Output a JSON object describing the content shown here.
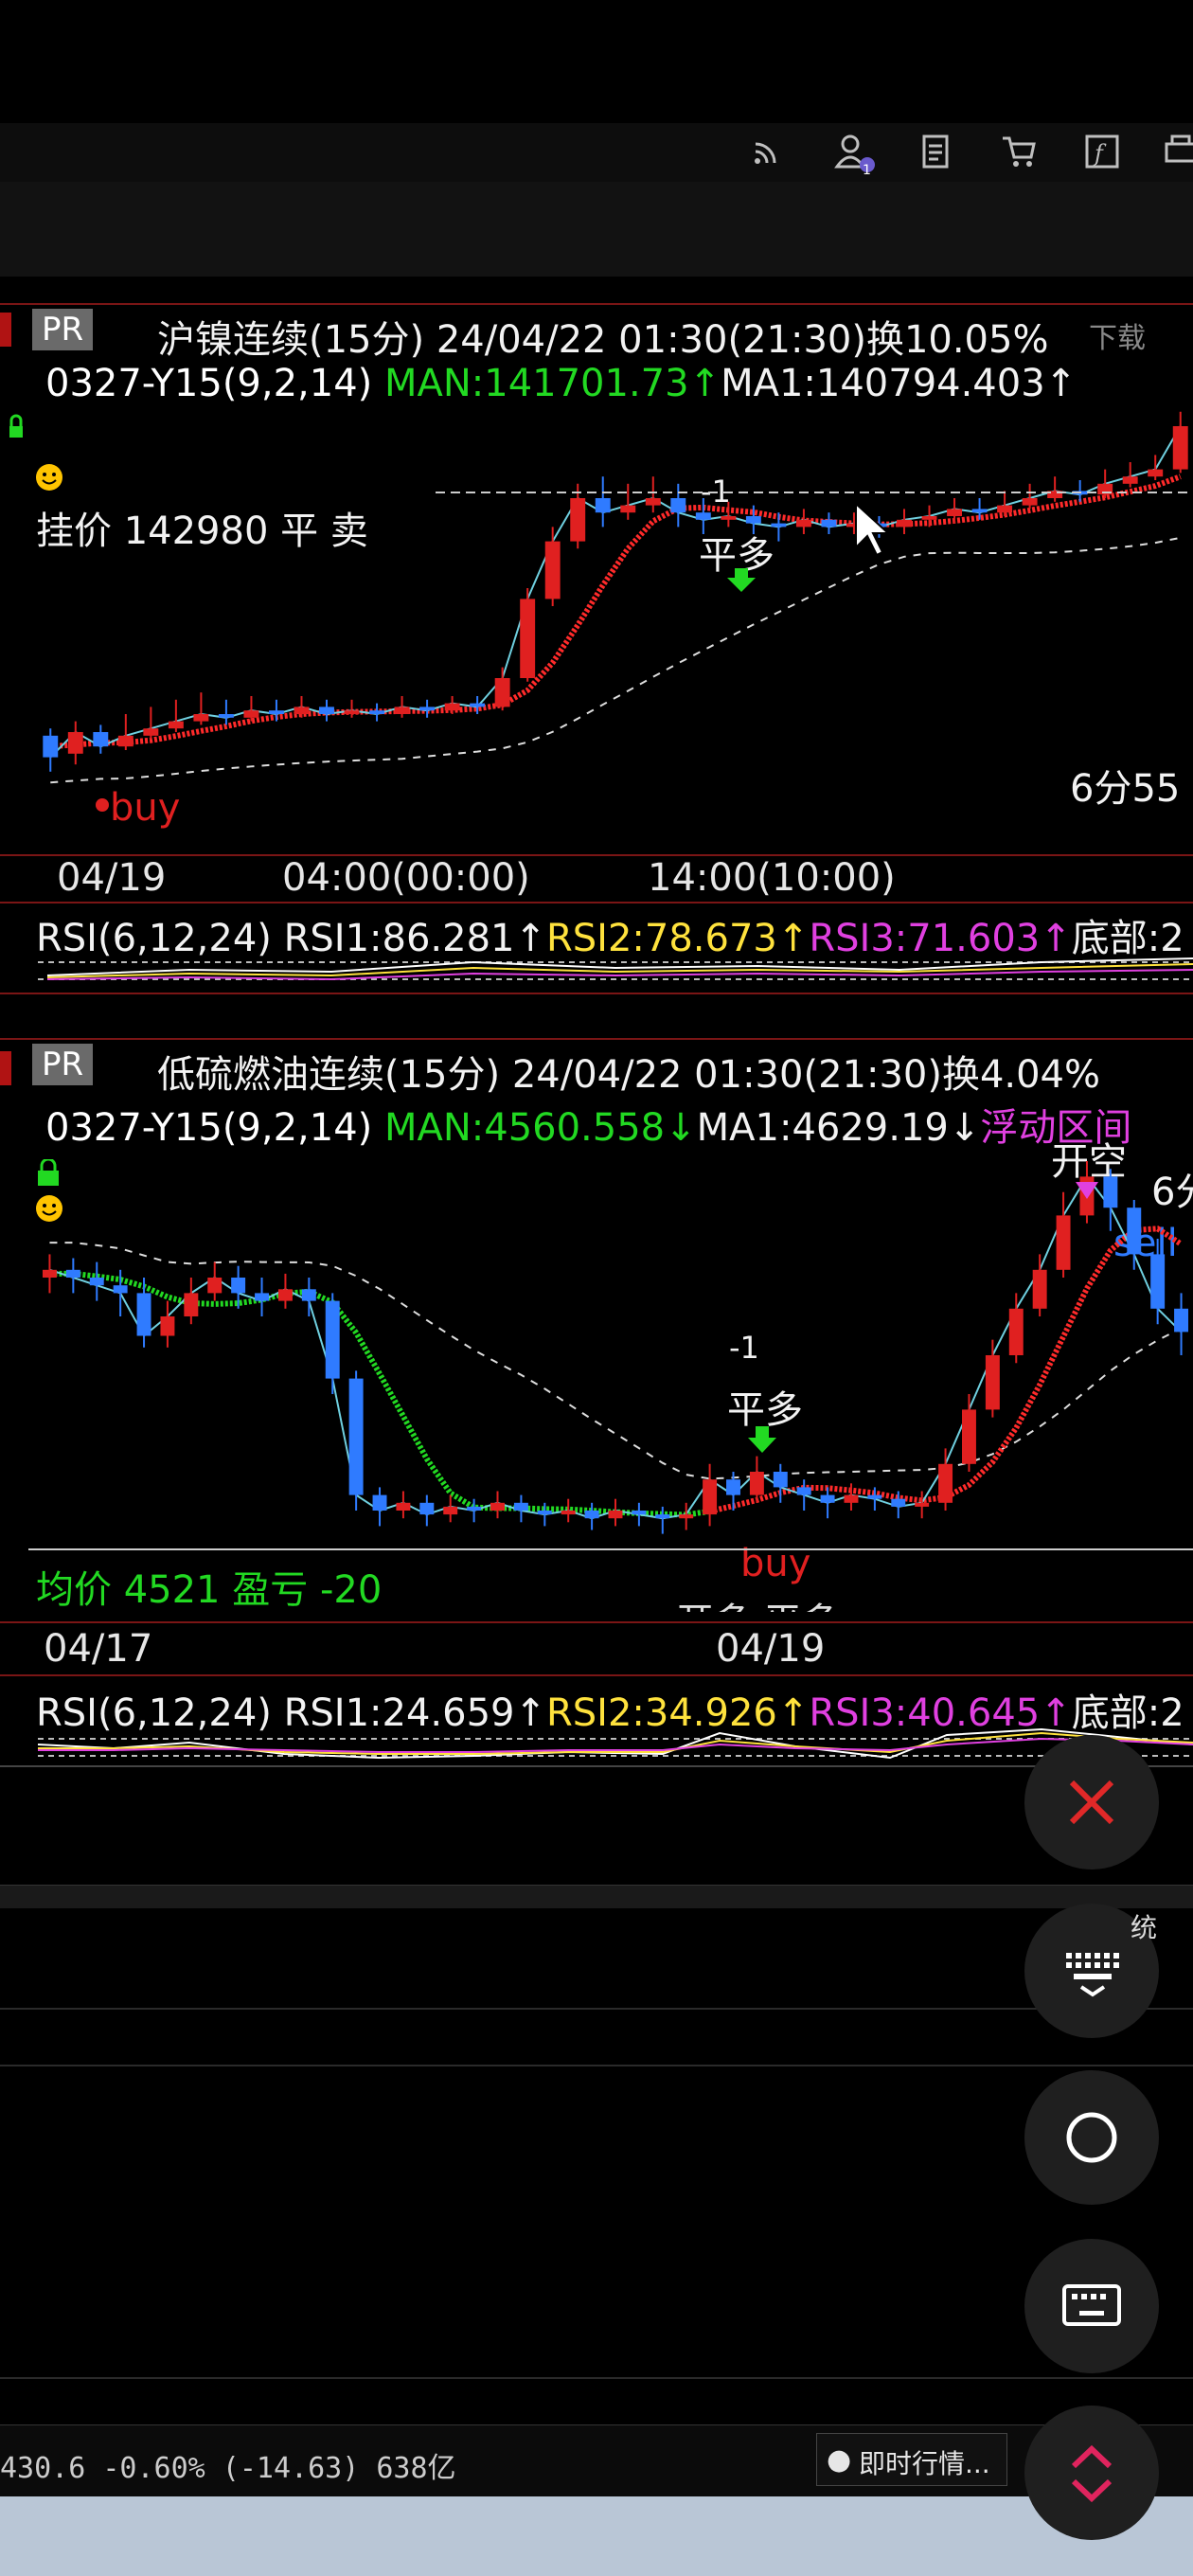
{
  "colors": {
    "up": "#e02020",
    "down": "#2f7bff",
    "ma_green": "#22d922",
    "ma_red": "#ff2a2a",
    "rsi1": "#ffffff",
    "rsi2": "#ffe23d",
    "rsi3": "#e040e0",
    "panel_border": "#7a1515"
  },
  "toolbar": {
    "icons": [
      "rss-icon",
      "user-icon",
      "document-icon",
      "cart-icon",
      "function-icon",
      "print-icon"
    ],
    "user_badge": "1"
  },
  "chart1": {
    "tag": "PR",
    "title": "沪镍连续(15分) 24/04/22 01:30(21:30)换10.05%",
    "download": "下载",
    "indicator_name": "0327-Y15(9,2,14)",
    "man": "MAN:141701.73↑",
    "ma1": "MA1:140794.403↑",
    "order": "挂价 142980 平 卖",
    "signal_minus": "-1",
    "signal_label": "平多",
    "buy_label": "buy",
    "timer": "6分55",
    "dates": [
      "04/19",
      "04:00(00:00)",
      "14:00(10:00)"
    ],
    "candles": [
      {
        "o": 14,
        "c": 8,
        "h": 16,
        "l": 4
      },
      {
        "o": 9,
        "c": 15,
        "h": 18,
        "l": 6
      },
      {
        "o": 15,
        "c": 11,
        "h": 17,
        "l": 9
      },
      {
        "o": 11,
        "c": 14,
        "h": 20,
        "l": 10
      },
      {
        "o": 14,
        "c": 16,
        "h": 22,
        "l": 13
      },
      {
        "o": 16,
        "c": 18,
        "h": 24,
        "l": 15
      },
      {
        "o": 18,
        "c": 20,
        "h": 26,
        "l": 17
      },
      {
        "o": 20,
        "c": 19,
        "h": 24,
        "l": 17
      },
      {
        "o": 19,
        "c": 21,
        "h": 25,
        "l": 18
      },
      {
        "o": 21,
        "c": 20,
        "h": 24,
        "l": 18
      },
      {
        "o": 20,
        "c": 22,
        "h": 25,
        "l": 19
      },
      {
        "o": 22,
        "c": 20,
        "h": 24,
        "l": 18
      },
      {
        "o": 20,
        "c": 21,
        "h": 24,
        "l": 19
      },
      {
        "o": 21,
        "c": 20,
        "h": 23,
        "l": 18
      },
      {
        "o": 20,
        "c": 22,
        "h": 25,
        "l": 19
      },
      {
        "o": 22,
        "c": 21,
        "h": 24,
        "l": 19
      },
      {
        "o": 21,
        "c": 23,
        "h": 25,
        "l": 20
      },
      {
        "o": 23,
        "c": 22,
        "h": 25,
        "l": 20
      },
      {
        "o": 22,
        "c": 30,
        "h": 33,
        "l": 21
      },
      {
        "o": 30,
        "c": 52,
        "h": 55,
        "l": 29
      },
      {
        "o": 52,
        "c": 68,
        "h": 72,
        "l": 50
      },
      {
        "o": 68,
        "c": 80,
        "h": 84,
        "l": 66
      },
      {
        "o": 80,
        "c": 76,
        "h": 86,
        "l": 72
      },
      {
        "o": 76,
        "c": 78,
        "h": 84,
        "l": 74
      },
      {
        "o": 78,
        "c": 80,
        "h": 86,
        "l": 76
      },
      {
        "o": 80,
        "c": 76,
        "h": 84,
        "l": 72
      },
      {
        "o": 76,
        "c": 74,
        "h": 80,
        "l": 70
      },
      {
        "o": 74,
        "c": 75,
        "h": 79,
        "l": 72
      },
      {
        "o": 75,
        "c": 73,
        "h": 78,
        "l": 70
      },
      {
        "o": 73,
        "c": 72,
        "h": 76,
        "l": 68
      },
      {
        "o": 72,
        "c": 74,
        "h": 77,
        "l": 70
      },
      {
        "o": 74,
        "c": 72,
        "h": 76,
        "l": 70
      },
      {
        "o": 72,
        "c": 73,
        "h": 76,
        "l": 70
      },
      {
        "o": 73,
        "c": 72,
        "h": 75,
        "l": 69
      },
      {
        "o": 72,
        "c": 74,
        "h": 77,
        "l": 70
      },
      {
        "o": 74,
        "c": 75,
        "h": 78,
        "l": 72
      },
      {
        "o": 75,
        "c": 77,
        "h": 80,
        "l": 73
      },
      {
        "o": 77,
        "c": 76,
        "h": 80,
        "l": 74
      },
      {
        "o": 76,
        "c": 78,
        "h": 82,
        "l": 75
      },
      {
        "o": 78,
        "c": 80,
        "h": 84,
        "l": 77
      },
      {
        "o": 80,
        "c": 82,
        "h": 86,
        "l": 79
      },
      {
        "o": 82,
        "c": 81,
        "h": 85,
        "l": 79
      },
      {
        "o": 81,
        "c": 84,
        "h": 88,
        "l": 80
      },
      {
        "o": 84,
        "c": 86,
        "h": 90,
        "l": 83
      },
      {
        "o": 86,
        "c": 88,
        "h": 92,
        "l": 85
      },
      {
        "o": 88,
        "c": 100,
        "h": 104,
        "l": 87
      }
    ]
  },
  "rsi1": {
    "name": "RSI(6,12,24)",
    "rsi1": "RSI1:86.281↑",
    "rsi2": "RSI2:78.673↑",
    "rsi3": "RSI3:71.603↑",
    "bottom": "底部:2"
  },
  "chart2": {
    "tag": "PR",
    "title": "低硫燃油连续(15分) 24/04/22 01:30(21:30)换4.04%",
    "indicator_name": "0327-Y15(9,2,14)",
    "man": "MAN:4560.558↓",
    "ma1": "MA1:4629.19↓",
    "float": "浮动区间",
    "open_short": "开空",
    "sell_label": "sell",
    "timer": "6分",
    "signal_minus": "-1",
    "signal_label": "平多",
    "buy_label": "buy",
    "avg": "均价 4521 盈亏 -20",
    "cut_text": "开多 平多",
    "dates": [
      "04/17",
      "04/19"
    ],
    "candles": [
      {
        "o": 70,
        "c": 72,
        "h": 76,
        "l": 66
      },
      {
        "o": 72,
        "c": 70,
        "h": 75,
        "l": 66
      },
      {
        "o": 70,
        "c": 68,
        "h": 74,
        "l": 64
      },
      {
        "o": 68,
        "c": 66,
        "h": 72,
        "l": 60
      },
      {
        "o": 66,
        "c": 55,
        "h": 70,
        "l": 52
      },
      {
        "o": 55,
        "c": 60,
        "h": 64,
        "l": 52
      },
      {
        "o": 60,
        "c": 66,
        "h": 70,
        "l": 58
      },
      {
        "o": 66,
        "c": 70,
        "h": 74,
        "l": 64
      },
      {
        "o": 70,
        "c": 66,
        "h": 73,
        "l": 62
      },
      {
        "o": 66,
        "c": 64,
        "h": 70,
        "l": 60
      },
      {
        "o": 64,
        "c": 67,
        "h": 71,
        "l": 62
      },
      {
        "o": 67,
        "c": 64,
        "h": 70,
        "l": 60
      },
      {
        "o": 64,
        "c": 44,
        "h": 66,
        "l": 40
      },
      {
        "o": 44,
        "c": 14,
        "h": 46,
        "l": 10
      },
      {
        "o": 14,
        "c": 10,
        "h": 16,
        "l": 6
      },
      {
        "o": 10,
        "c": 12,
        "h": 15,
        "l": 8
      },
      {
        "o": 12,
        "c": 9,
        "h": 14,
        "l": 6
      },
      {
        "o": 9,
        "c": 11,
        "h": 14,
        "l": 7
      },
      {
        "o": 11,
        "c": 10,
        "h": 13,
        "l": 7
      },
      {
        "o": 10,
        "c": 12,
        "h": 15,
        "l": 8
      },
      {
        "o": 12,
        "c": 10,
        "h": 14,
        "l": 7
      },
      {
        "o": 10,
        "c": 9,
        "h": 12,
        "l": 6
      },
      {
        "o": 9,
        "c": 10,
        "h": 13,
        "l": 7
      },
      {
        "o": 10,
        "c": 8,
        "h": 12,
        "l": 5
      },
      {
        "o": 8,
        "c": 10,
        "h": 13,
        "l": 6
      },
      {
        "o": 10,
        "c": 9,
        "h": 12,
        "l": 6
      },
      {
        "o": 9,
        "c": 8,
        "h": 11,
        "l": 4
      },
      {
        "o": 8,
        "c": 9,
        "h": 12,
        "l": 5
      },
      {
        "o": 9,
        "c": 18,
        "h": 22,
        "l": 6
      },
      {
        "o": 18,
        "c": 14,
        "h": 20,
        "l": 10
      },
      {
        "o": 14,
        "c": 20,
        "h": 24,
        "l": 12
      },
      {
        "o": 20,
        "c": 16,
        "h": 22,
        "l": 12
      },
      {
        "o": 16,
        "c": 14,
        "h": 18,
        "l": 10
      },
      {
        "o": 14,
        "c": 12,
        "h": 16,
        "l": 8
      },
      {
        "o": 12,
        "c": 14,
        "h": 17,
        "l": 10
      },
      {
        "o": 14,
        "c": 13,
        "h": 16,
        "l": 10
      },
      {
        "o": 13,
        "c": 11,
        "h": 15,
        "l": 8
      },
      {
        "o": 11,
        "c": 12,
        "h": 15,
        "l": 8
      },
      {
        "o": 12,
        "c": 22,
        "h": 26,
        "l": 10
      },
      {
        "o": 22,
        "c": 36,
        "h": 40,
        "l": 20
      },
      {
        "o": 36,
        "c": 50,
        "h": 54,
        "l": 34
      },
      {
        "o": 50,
        "c": 62,
        "h": 66,
        "l": 48
      },
      {
        "o": 62,
        "c": 72,
        "h": 76,
        "l": 60
      },
      {
        "o": 72,
        "c": 86,
        "h": 92,
        "l": 70
      },
      {
        "o": 86,
        "c": 96,
        "h": 100,
        "l": 84
      },
      {
        "o": 96,
        "c": 88,
        "h": 98,
        "l": 82
      },
      {
        "o": 88,
        "c": 76,
        "h": 90,
        "l": 72
      },
      {
        "o": 76,
        "c": 62,
        "h": 80,
        "l": 58
      },
      {
        "o": 62,
        "c": 56,
        "h": 66,
        "l": 50
      }
    ]
  },
  "rsi2": {
    "name": "RSI(6,12,24)",
    "rsi1": "RSI1:24.659↑",
    "rsi2": "RSI2:34.926↑",
    "rsi3": "RSI3:40.645↑",
    "bottom": "底部:2"
  },
  "status": {
    "quote": "430.6 -0.60% (-14.63) 638亿",
    "news": "即时行情..."
  },
  "floating": {
    "tab_char": "统"
  }
}
